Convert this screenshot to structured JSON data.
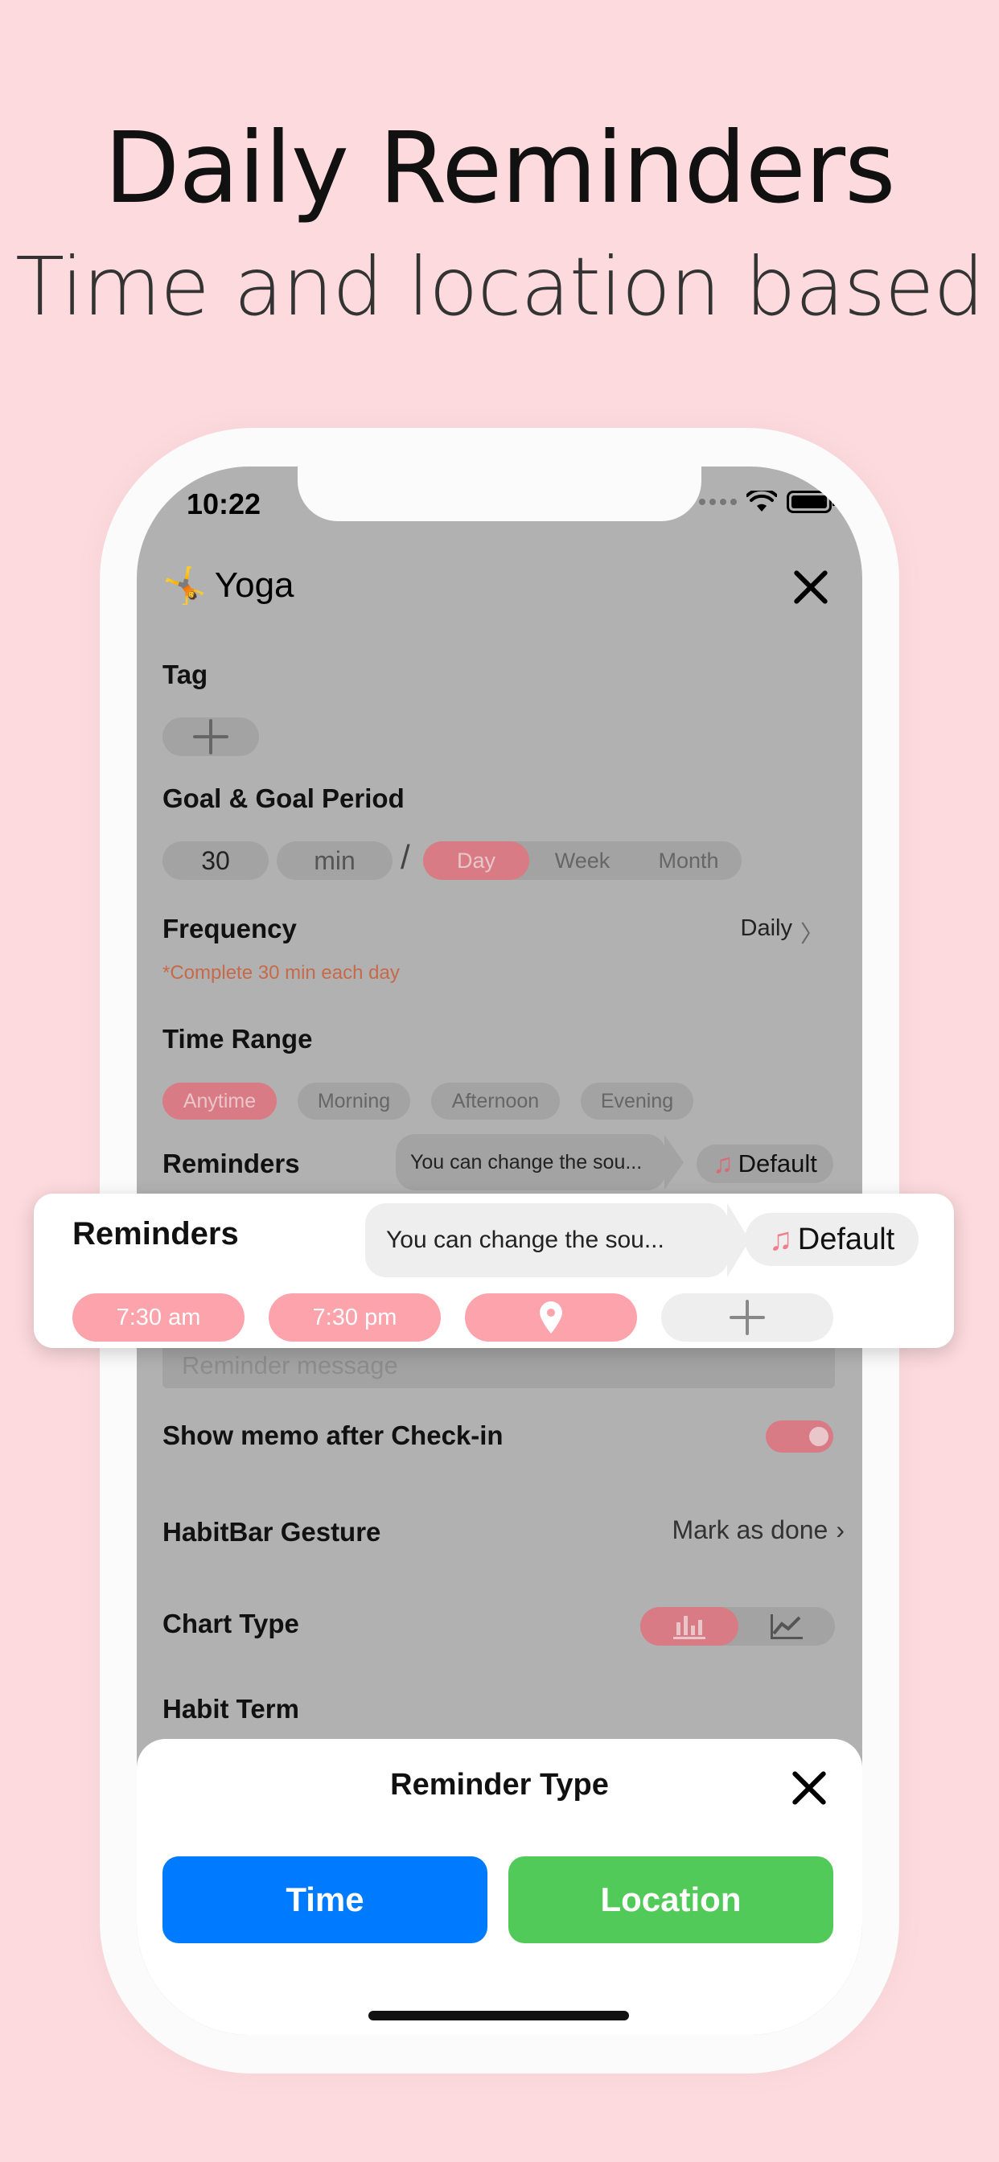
{
  "headline": {
    "title": "Daily Reminders",
    "subtitle": "Time and location based"
  },
  "status_bar": {
    "time": "10:22"
  },
  "habit": {
    "emoji": "🤸",
    "name": "Yoga"
  },
  "tag": {
    "label": "Tag"
  },
  "goal": {
    "label": "Goal & Goal Period",
    "amount": "30",
    "unit": "min",
    "separator": "/",
    "periods": [
      "Day",
      "Week",
      "Month"
    ],
    "selected_period": "Day"
  },
  "frequency": {
    "label": "Frequency",
    "value": "Daily",
    "chevron": "〉",
    "note": "*Complete 30 min each day"
  },
  "time_range": {
    "label": "Time Range",
    "options": [
      "Anytime",
      "Morning",
      "Afternoon",
      "Evening"
    ],
    "selected": "Anytime"
  },
  "reminders_bg": {
    "label": "Reminders",
    "tooltip": "You can change the sou...",
    "sound": "Default"
  },
  "reminders_card": {
    "label": "Reminders",
    "tooltip": "You can change the sou...",
    "sound": "Default",
    "items": [
      "7:30 am",
      "7:30 pm"
    ]
  },
  "reminder_message": {
    "placeholder": "Reminder message"
  },
  "memo": {
    "label": "Show memo after Check-in",
    "enabled": true
  },
  "gesture": {
    "label": "HabitBar Gesture",
    "value": "Mark as done",
    "chevron": "›"
  },
  "chart_type": {
    "label": "Chart Type",
    "options": [
      "bar-chart-icon",
      "line-chart-icon"
    ],
    "selected": "bar-chart-icon"
  },
  "habit_term": {
    "label": "Habit Term"
  },
  "sheet": {
    "title": "Reminder Type",
    "time_button": "Time",
    "location_button": "Location"
  },
  "colors": {
    "background": "#fcdadd",
    "accent_pink": "#fca3ab",
    "time_blue": "#007aff",
    "location_green": "#52ca5a"
  }
}
